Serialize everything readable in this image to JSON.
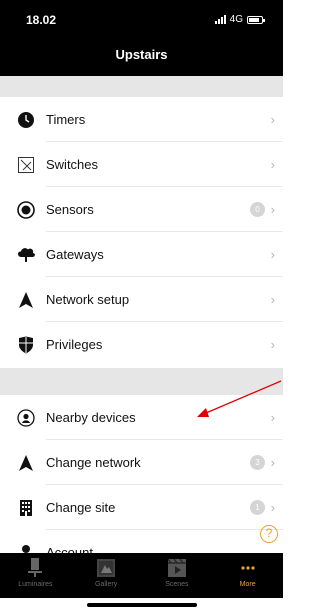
{
  "status": {
    "time": "18.02",
    "network": "4G"
  },
  "header": {
    "title": "Upstairs"
  },
  "menu": {
    "group1": [
      {
        "label": "Timers",
        "icon": "clock-icon"
      },
      {
        "label": "Switches",
        "icon": "switch-icon"
      },
      {
        "label": "Sensors",
        "icon": "sensor-icon",
        "badge": "0"
      },
      {
        "label": "Gateways",
        "icon": "gateway-cloud-icon"
      },
      {
        "label": "Network setup",
        "icon": "network-a-icon"
      },
      {
        "label": "Privileges",
        "icon": "shield-icon"
      }
    ],
    "group2": [
      {
        "label": "Nearby devices",
        "icon": "nearby-device-icon"
      },
      {
        "label": "Change network",
        "icon": "network-a-icon",
        "badge": "3"
      },
      {
        "label": "Change site",
        "icon": "building-icon",
        "badge": "1"
      },
      {
        "label": "Account",
        "icon": "person-icon"
      }
    ]
  },
  "help_symbol": "?",
  "tabs": [
    {
      "label": "Luminaires",
      "icon": "luminaire-icon",
      "active": false
    },
    {
      "label": "Gallery",
      "icon": "gallery-icon",
      "active": false
    },
    {
      "label": "Scenes",
      "icon": "scenes-icon",
      "active": false
    },
    {
      "label": "More",
      "icon": "more-dots-icon",
      "active": true
    }
  ],
  "colors": {
    "accent": "#e8a33d",
    "annotation_arrow": "#e00000",
    "section_bg": "#e6e6e6"
  }
}
